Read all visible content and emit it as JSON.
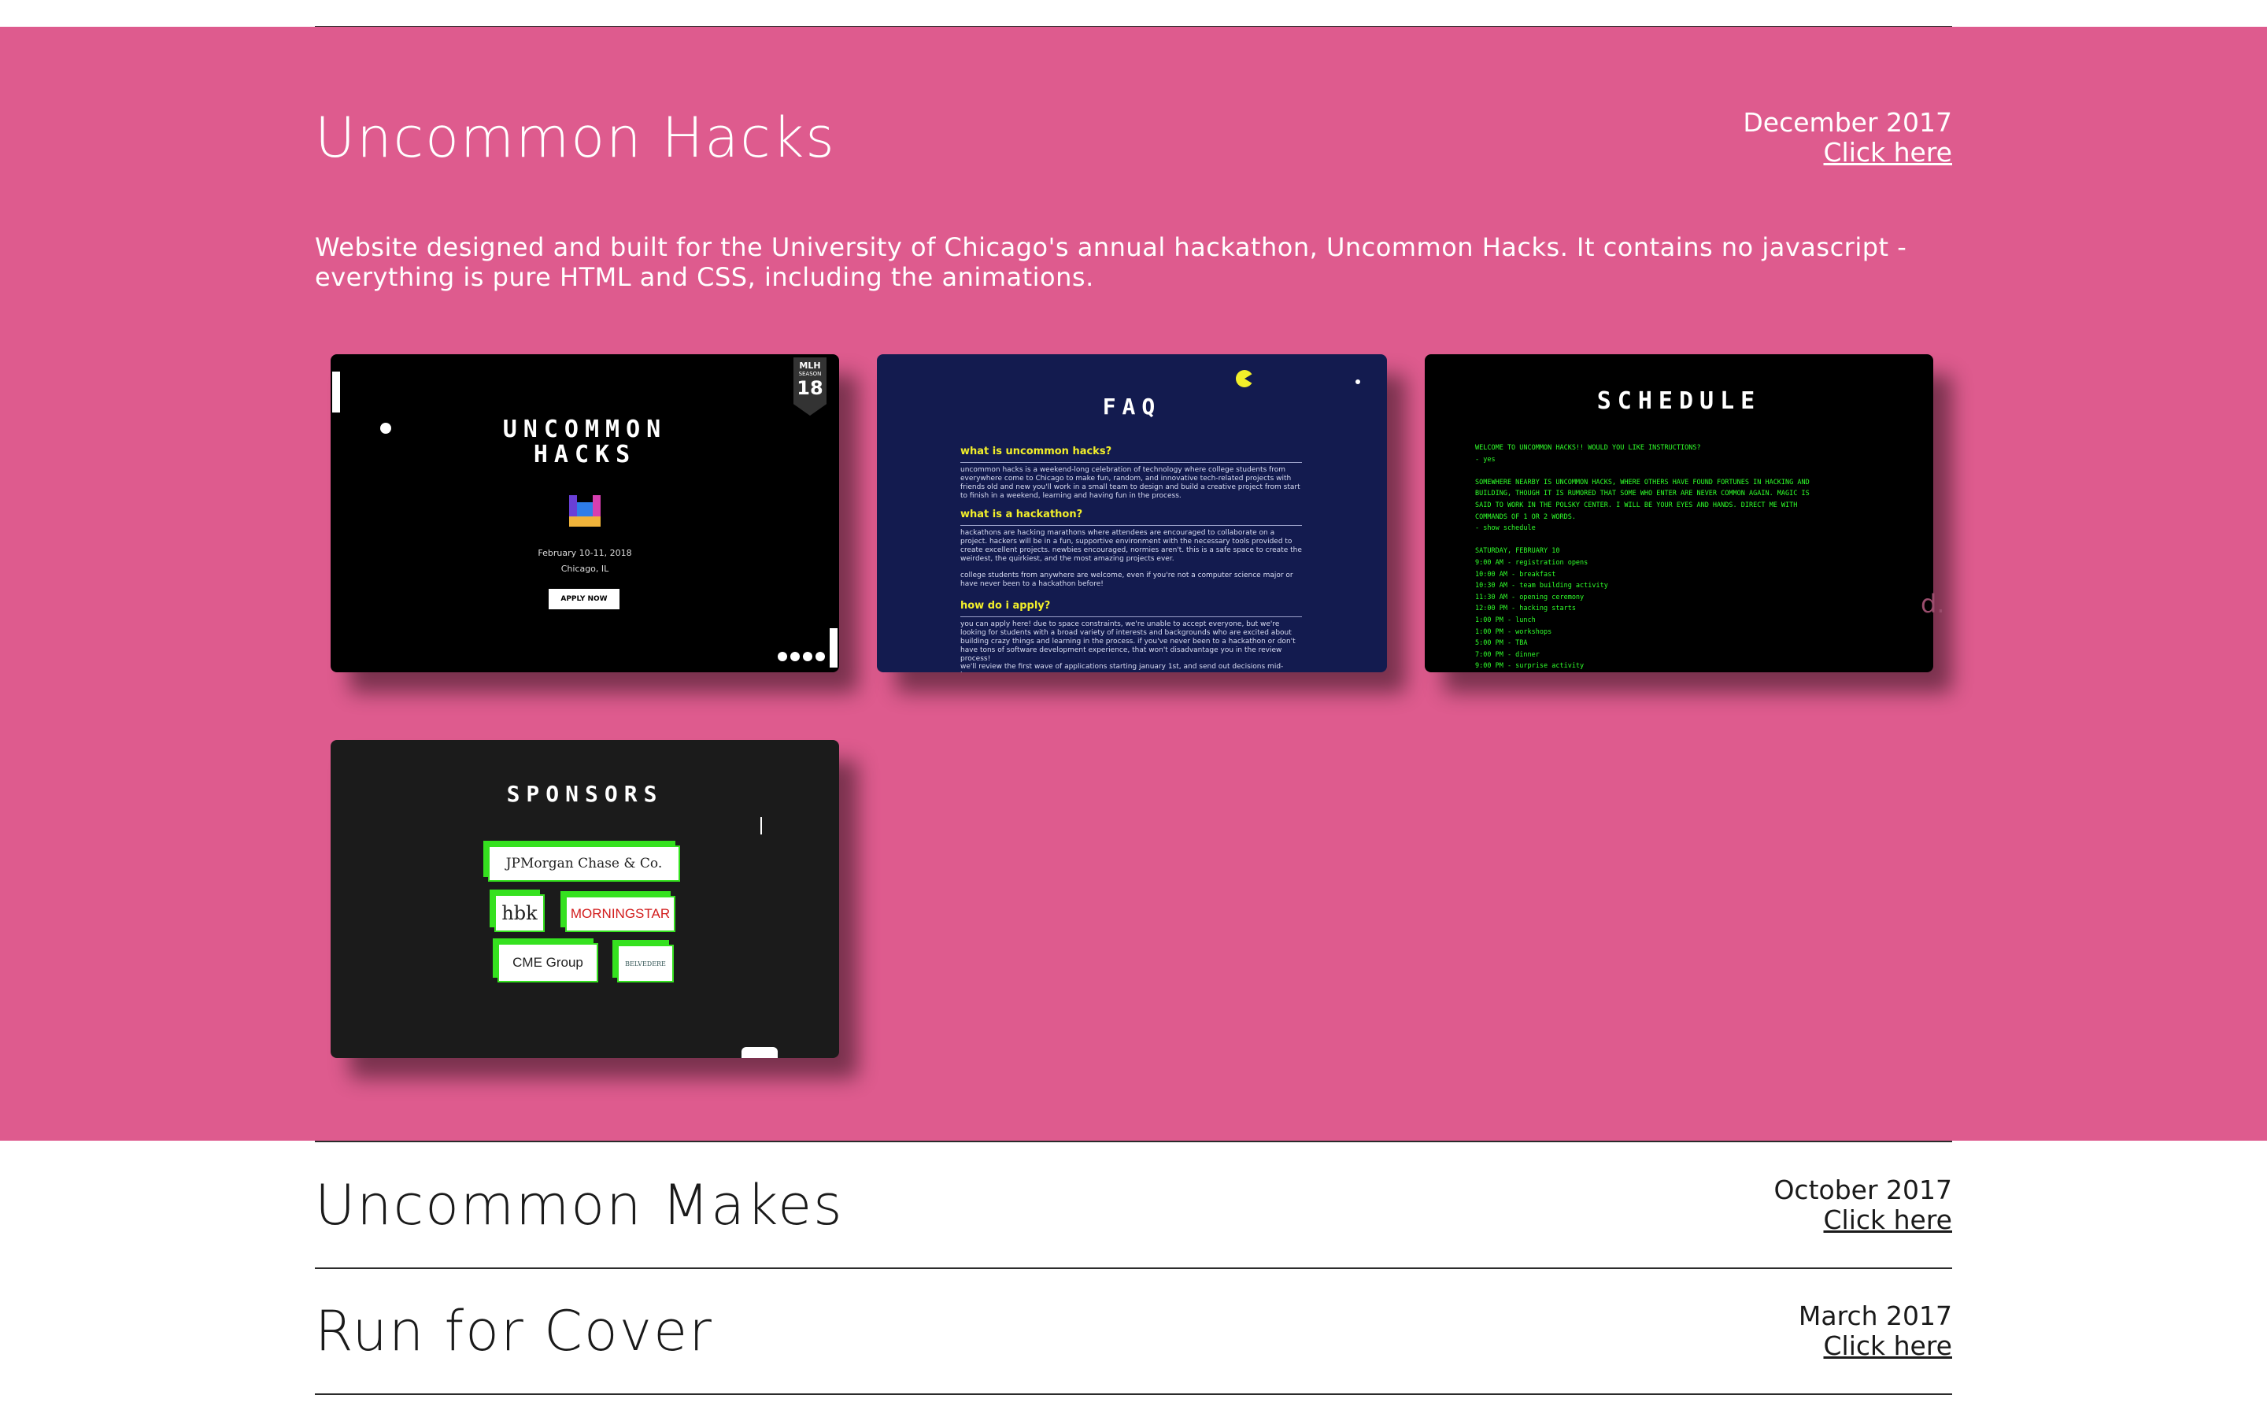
{
  "projects": [
    {
      "title": "Uncommon Hacks",
      "date": "December 2017",
      "link": "Click here",
      "description": "Website designed and built for the University of Chicago's annual hackathon, Uncommon Hacks. It contains no javascript - everything is pure HTML and CSS, including the animations.",
      "band_color": "#de5b8e"
    },
    {
      "title": "Uncommon Makes",
      "date": "October 2017",
      "link": "Click here"
    },
    {
      "title": "Run for Cover",
      "date": "March 2017",
      "link": "Click here"
    }
  ],
  "screenshots": {
    "home": {
      "title_line1": "UNCOMMON",
      "title_line2": "HACKS",
      "badge_top": "MLH",
      "badge_mid": "SEASON",
      "badge_num": "18",
      "date": "February 10-11, 2018",
      "location": "Chicago, IL",
      "apply": "APPLY NOW"
    },
    "faq": {
      "title": "FAQ",
      "q1": "what is uncommon hacks?",
      "a1": "uncommon hacks is a weekend-long celebration of technology where college students from everywhere come to Chicago to make fun, random, and innovative tech-related projects with friends old and new you'll work in a small team to design and build a creative project from start to finish in a weekend, learning and having fun in the process.",
      "q2": "what is a hackathon?",
      "a2": "hackathons are hacking marathons where attendees are encouraged to collaborate on a project. hackers will be in a fun, supportive environment with the necessary tools provided to create excellent projects. newbies encouraged, normies aren't. this is a safe space to create the weirdest, the quirkiest, and the most amazing projects ever.",
      "a2b": "college students from anywhere are welcome, even if you're not a computer science major or have never been to a hackathon before!",
      "q3": "how do i apply?",
      "a3": "you can apply here! due to space constraints, we're unable to accept everyone, but we're looking for students with a broad variety of interests and backgrounds who are excited about building crazy things and learning in the process. if you've never been to a hackathon or don't have tons of software development experience, that won't disadvantage you in the review process!",
      "a3b": "we'll review the first wave of applications starting january 1st, and send out decisions mid-january"
    },
    "schedule": {
      "title": "SCHEDULE",
      "terminal": "WELCOME TO UNCOMMON HACKS!! WOULD YOU LIKE INSTRUCTIONS?\n- yes\n\nSOMEWHERE NEARBY IS UNCOMMON HACKS, WHERE OTHERS HAVE FOUND FORTUNES IN HACKING AND\nBUILDING, THOUGH IT IS RUMORED THAT SOME WHO ENTER ARE NEVER COMMON AGAIN. MAGIC IS\nSAID TO WORK IN THE POLSKY CENTER. I WILL BE YOUR EYES AND HANDS. DIRECT ME WITH\nCOMMANDS OF 1 OR 2 WORDS.\n- show schedule\n\nSATURDAY, FEBRUARY 10\n9:00 AM - registration opens\n10:00 AM - breakfast\n10:30 AM - team building activity\n11:30 AM - opening ceremony\n12:00 PM - hacking starts\n1:00 PM - lunch\n1:00 PM - workshops\n5:00 PM - TBA\n7:00 PM - dinner\n9:00 PM - surprise activity",
      "ghost": "d."
    },
    "sponsors": {
      "title": "SPONSORS",
      "logo1": "JPMorgan Chase & Co.",
      "logo2": "hbk",
      "logo3": "MORNINGSTAR",
      "logo4": "CME Group",
      "logo5": "BELVEDERE"
    }
  }
}
